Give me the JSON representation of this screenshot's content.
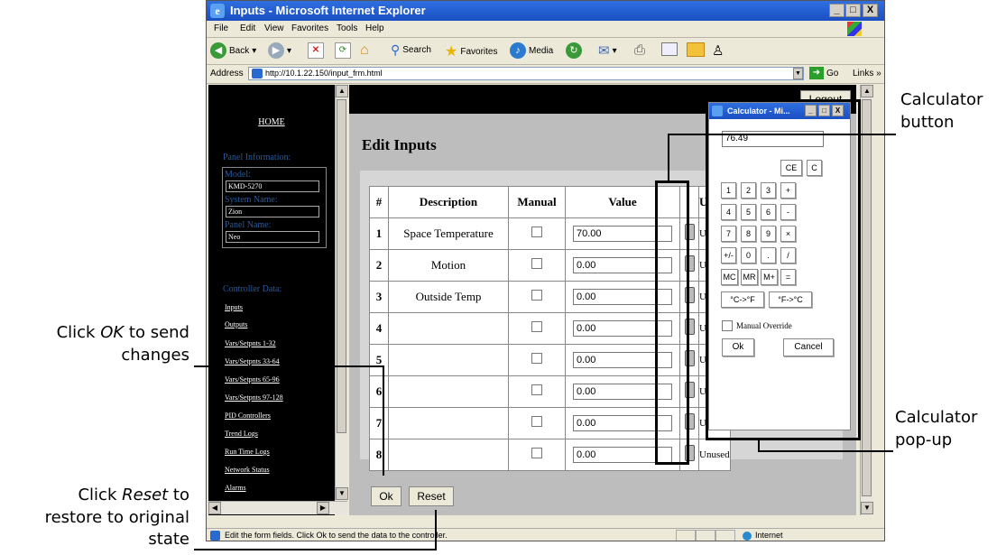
{
  "window": {
    "title": "Inputs - Microsoft Internet Explorer",
    "ie_glyph": "e",
    "minimize": "_",
    "maximize": "□",
    "close": "X"
  },
  "menu": [
    "File",
    "Edit",
    "View",
    "Favorites",
    "Tools",
    "Help"
  ],
  "toolbar": {
    "back": "Back",
    "search": "Search",
    "favorites": "Favorites",
    "media": "Media"
  },
  "address": {
    "label": "Address",
    "url": "http://10.1.22.150/input_frm.html",
    "go": "Go",
    "links": "Links »"
  },
  "sidebar": {
    "home": "HOME",
    "panel_info_heading": "Panel Information:",
    "model_label": "Model:",
    "model_value": "KMD-5270",
    "system_label": "System Name:",
    "system_value": "Zion",
    "panel_label": "Panel Name:",
    "panel_value": "Neo",
    "controller_heading": "Controller Data:",
    "links": [
      "Inputs",
      "Outputs",
      "Vars/Setpnts 1-32",
      "Vars/Setpnts 33-64",
      "Vars/Setpnts 65-96",
      "Vars/Setpnts 97-128",
      "PID Controllers",
      "Trend Logs",
      "Run Time Logs",
      "Network Status",
      "Alarms"
    ]
  },
  "main": {
    "logout": "Logout",
    "heading": "Edit Inputs",
    "columns": [
      "#",
      "Description",
      "Manual",
      "Value",
      "",
      "Un"
    ],
    "rows": [
      {
        "num": "1",
        "desc": "Space Temperature",
        "value": "70.00",
        "unit": "Un"
      },
      {
        "num": "2",
        "desc": "Motion",
        "value": "0.00",
        "unit": "Un"
      },
      {
        "num": "3",
        "desc": "Outside Temp",
        "value": "0.00",
        "unit": "Un"
      },
      {
        "num": "4",
        "desc": "",
        "value": "0.00",
        "unit": "Un"
      },
      {
        "num": "5",
        "desc": "",
        "value": "0.00",
        "unit": "Un"
      },
      {
        "num": "6",
        "desc": "",
        "value": "0.00",
        "unit": "Un"
      },
      {
        "num": "7",
        "desc": "",
        "value": "0.00",
        "unit": "Un"
      },
      {
        "num": "8",
        "desc": "",
        "value": "0.00",
        "unit": "Unused"
      }
    ],
    "ok": "Ok",
    "reset": "Reset"
  },
  "statusbar": {
    "text": "Edit the form fields.  Click Ok to send the data to the controller.",
    "zone": "Internet"
  },
  "calculator": {
    "title": "Calculator - Mi...",
    "display": "76.49",
    "keys": [
      [
        "CE",
        "C"
      ],
      [
        "1",
        "2",
        "3",
        "+"
      ],
      [
        "4",
        "5",
        "6",
        "-"
      ],
      [
        "7",
        "8",
        "9",
        "×"
      ],
      [
        "+/-",
        "0",
        ".",
        "/"
      ],
      [
        "MC",
        "MR",
        "M+",
        "="
      ],
      [
        "°C->°F",
        "°F->°C"
      ]
    ],
    "manual_override": "Manual Override",
    "ok": "Ok",
    "cancel": "Cancel"
  },
  "annotations": {
    "calc_button_1": "Calculator",
    "calc_button_2": "button",
    "calc_popup_1": "Calculator",
    "calc_popup_2": "pop-up",
    "ok_1_pre": "Click ",
    "ok_1_em": "OK",
    "ok_1_post": " to send",
    "ok_2": "changes",
    "reset_1_pre": "Click ",
    "reset_1_em": "Reset",
    "reset_1_post": " to",
    "reset_2": "restore to original",
    "reset_3": "state"
  }
}
